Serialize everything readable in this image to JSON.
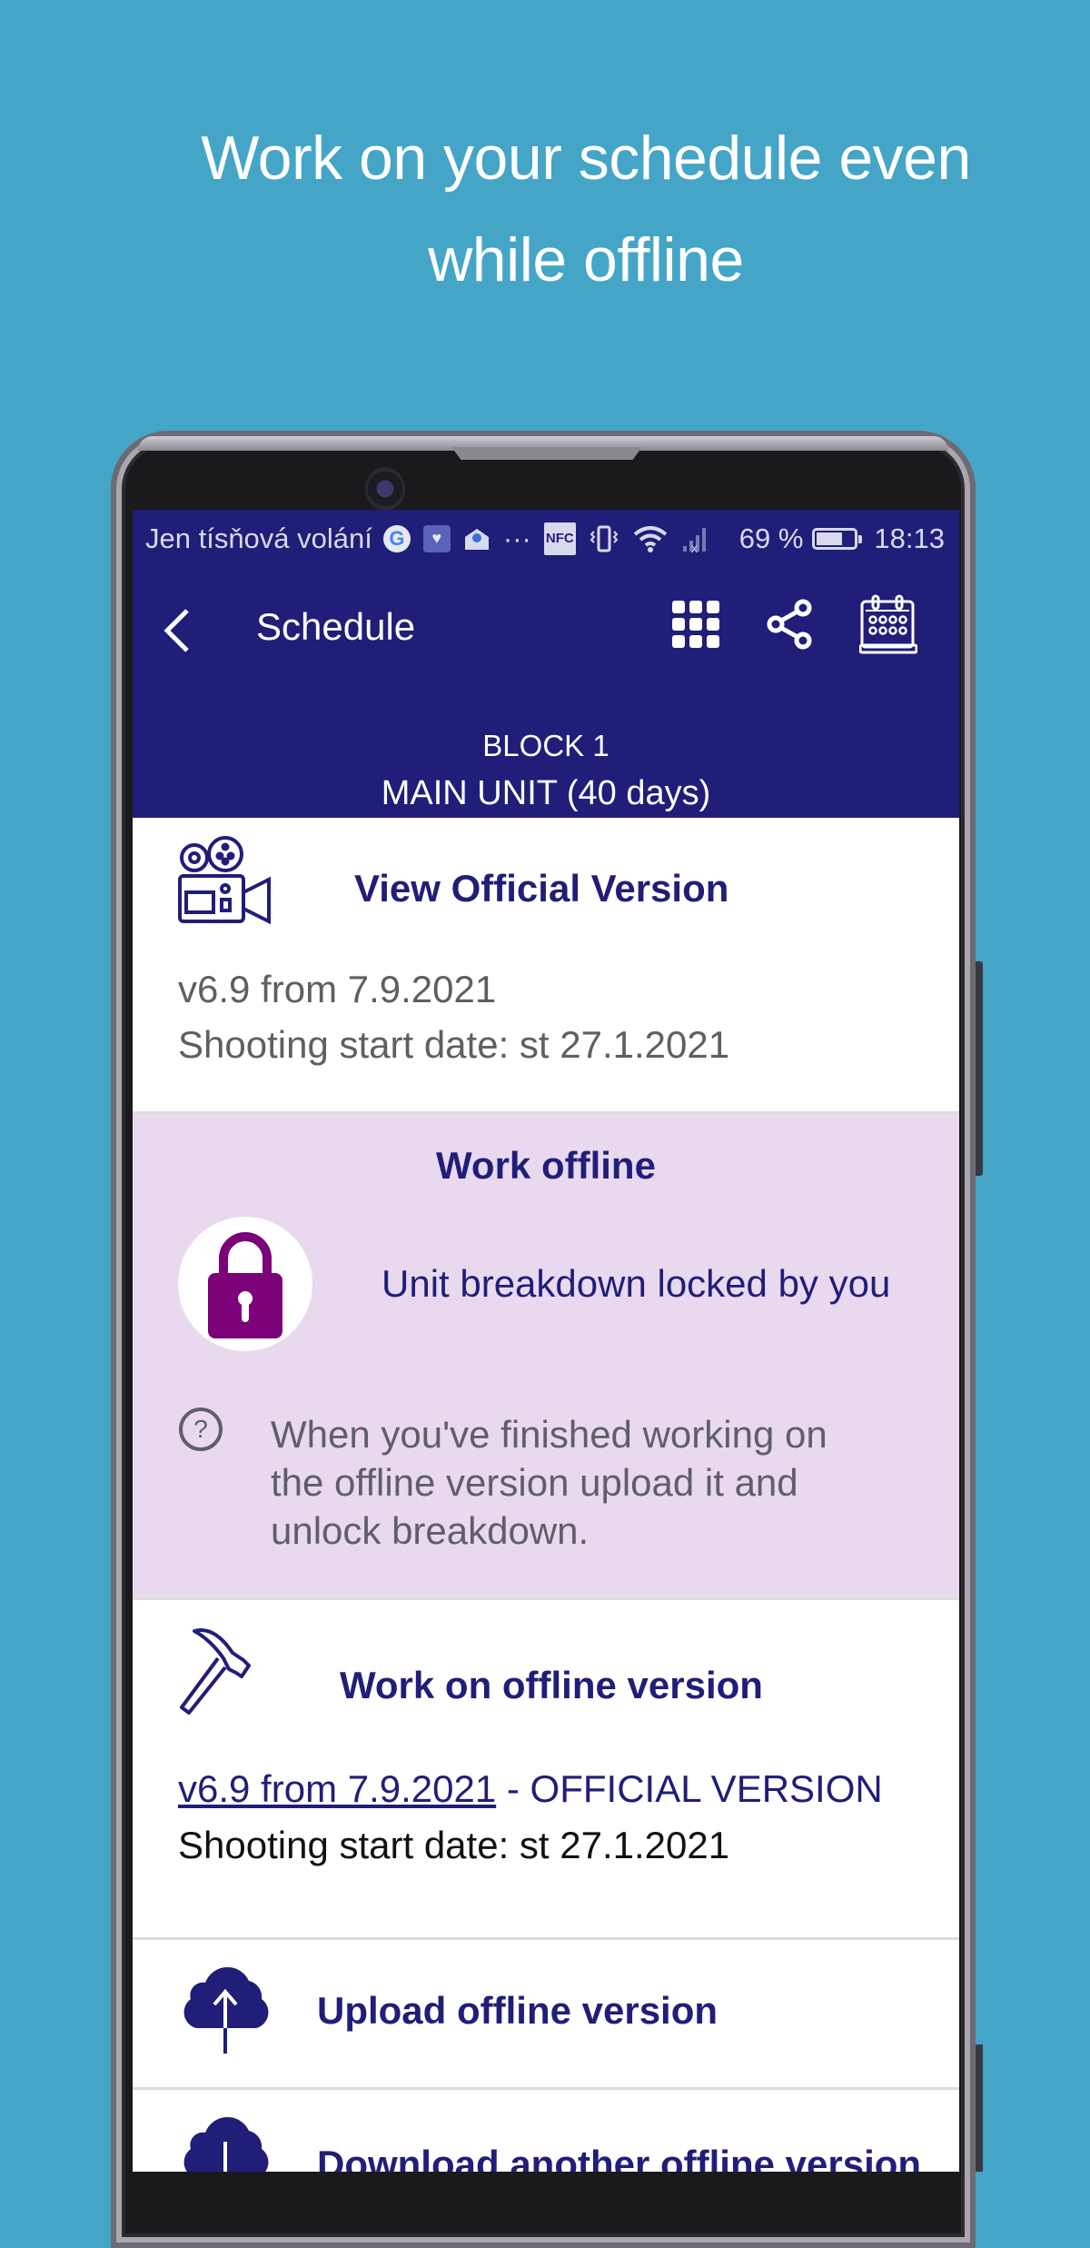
{
  "headline": {
    "line1": "Work on your schedule even",
    "line2": "while offline"
  },
  "status_bar": {
    "carrier": "Jen tísňová volání",
    "icons": [
      "google-icon",
      "health-icon",
      "mail-icon",
      "more-icon",
      "nfc-icon",
      "vibrate-icon",
      "wifi-icon",
      "no-signal-icon"
    ],
    "nfc_label": "NFC",
    "more": "···",
    "battery_percent_text": "69 %",
    "battery_level": 0.69,
    "time": "18:13"
  },
  "app_bar": {
    "title": "Schedule",
    "actions": [
      "grid-icon",
      "share-icon",
      "calendar-icon"
    ],
    "block": "BLOCK 1",
    "unit": "MAIN UNIT (40 days)"
  },
  "official": {
    "title": "View Official Version",
    "version": "v6.9 from 7.9.2021",
    "shooting_start": "Shooting start date: st 27.1.2021"
  },
  "offline": {
    "title": "Work offline",
    "lock_status": "Unit breakdown locked by you",
    "help_text_1": "When you've finished working on",
    "help_text_2": "the offline version upload it and",
    "help_text_3": "unlock breakdown."
  },
  "work_offline": {
    "title": "Work on offline version",
    "version_link": "v6.9 from 7.9.2021",
    "version_suffix": " - OFFICIAL VERSION",
    "shooting_start": "Shooting start date: st 27.1.2021"
  },
  "upload": {
    "label": "Upload offline version"
  },
  "download": {
    "label": "Download another offline version"
  },
  "colors": {
    "background": "#44a5c7",
    "navy": "#201e78",
    "offline_bg": "#e9d9ef",
    "lock": "#7b0278"
  }
}
